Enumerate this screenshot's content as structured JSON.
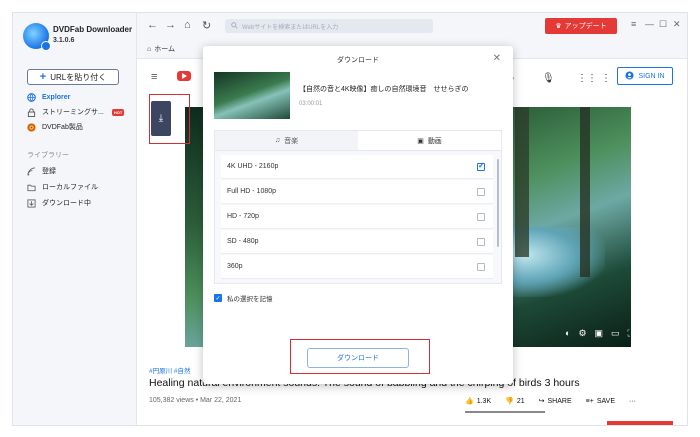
{
  "app": {
    "name": "DVDFab Downloader",
    "version": "3.1.0.6"
  },
  "sidebar": {
    "paste_button": "URLを貼り付く",
    "items": [
      {
        "label": "Explorer",
        "icon": "globe-icon"
      },
      {
        "label": "ストリーミングサ...",
        "icon": "lock-icon",
        "badge": "HOT"
      },
      {
        "label": "DVDFab製品",
        "icon": "dvdfab-icon"
      }
    ],
    "library_title": "ライブラリー",
    "library_items": [
      {
        "label": "登録",
        "icon": "signal-icon"
      },
      {
        "label": "ローカルファイル",
        "icon": "folder-icon"
      },
      {
        "label": "ダウンロード中",
        "icon": "download-icon"
      }
    ]
  },
  "topbar": {
    "url_placeholder": "Webサイトを検索またはURLを入力",
    "update_button": "アップデート",
    "home_tab": "ホーム"
  },
  "youtube": {
    "sign_in": "SIGN IN",
    "tags": "#円原川 #自然",
    "title": "Healing natural environment sounds. The sound of babbling and the chirping of birds 3 hours",
    "views": "105,382 views • Mar 22, 2021",
    "likes": "1.3K",
    "dislikes": "21",
    "share": "SHARE",
    "save": "SAVE"
  },
  "modal": {
    "title": "ダウンロード",
    "video_title": "【自然の音と4K映像】癒しの自然環境音　せせらぎの",
    "duration": "03:00:01",
    "tabs": [
      {
        "label": "音楽",
        "icon": "music-icon",
        "active": false
      },
      {
        "label": "動画",
        "icon": "video-icon",
        "active": true
      }
    ],
    "qualities": [
      {
        "label": "4K UHD - 2160p",
        "checked": true
      },
      {
        "label": "Full HD - 1080p",
        "checked": false
      },
      {
        "label": "HD - 720p",
        "checked": false
      },
      {
        "label": "SD - 480p",
        "checked": false
      },
      {
        "label": "360p",
        "checked": false
      }
    ],
    "remember_label": "私の選択を記憶",
    "download_button": "ダウンロード"
  },
  "colors": {
    "accent": "#1a73e8",
    "highlight": "#d32f2f",
    "update": "#e53935"
  }
}
